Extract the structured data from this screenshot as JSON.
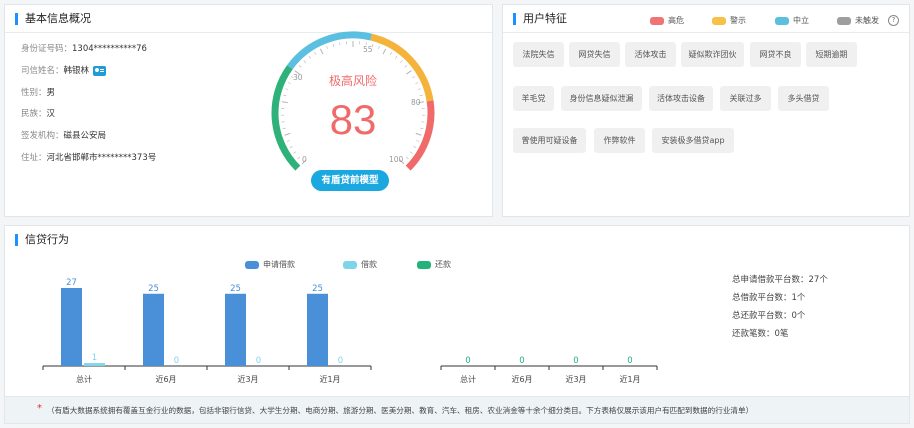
{
  "basic": {
    "title": "基本信息概况",
    "rows": [
      {
        "label": "身份证号码：",
        "value": "1304**********76"
      },
      {
        "label": "司信姓名：",
        "value": "韩银林"
      },
      {
        "label": "性别：",
        "value": "男"
      },
      {
        "label": "民族：",
        "value": "汉"
      },
      {
        "label": "签发机构：",
        "value": "磁县公安局"
      },
      {
        "label": "住址：",
        "value": "河北省邯郸市********373号"
      }
    ],
    "id_icon": "id-card-icon"
  },
  "gauge": {
    "risk_label": "极高风险",
    "score": "83",
    "score_value": 83,
    "ticks": [
      "0",
      "30",
      "55",
      "80",
      "100"
    ],
    "model_button": "有盾贷前模型",
    "colors": {
      "low": "#2fb27a",
      "mid": "#5bbfe0",
      "warn": "#f4b43b",
      "high": "#f06a6a"
    }
  },
  "user_features": {
    "title": "用户特征",
    "legend": [
      {
        "label": "高危",
        "color": "#f07474"
      },
      {
        "label": "警示",
        "color": "#f7c046"
      },
      {
        "label": "中立",
        "color": "#5bc0de"
      },
      {
        "label": "未触发",
        "color": "#9e9e9e"
      }
    ],
    "help_icon": "question-circle-icon",
    "tags": [
      [
        "法院失信",
        "网贷失信",
        "活体攻击",
        "疑似欺诈团伙",
        "网贷不良",
        "短期逾期"
      ],
      [
        "羊毛党",
        "身份信息疑似泄漏",
        "活体攻击设备",
        "关联过多",
        "多头借贷"
      ],
      [
        "曾使用可疑设备",
        "作弊软件",
        "安装极多借贷app"
      ]
    ]
  },
  "credit": {
    "title": "信贷行为",
    "legend": [
      {
        "label": "申请借款",
        "color": "#4a90d9"
      },
      {
        "label": "借款",
        "color": "#7fd4ea"
      },
      {
        "label": "还款",
        "color": "#23b27a"
      }
    ],
    "stats": [
      {
        "label": "总申请借款平台数：",
        "value": "27个"
      },
      {
        "label": "总借款平台数：",
        "value": "1个"
      },
      {
        "label": "总还款平台数：",
        "value": "0个"
      },
      {
        "label": "还款笔数：",
        "value": "0笔"
      }
    ],
    "footer_star": "*",
    "footer_text": "（有盾大数据系统拥有覆盖互金行业的数据，包括非银行信贷、大学生分期、电商分期、旅游分期、医美分期、教育、汽车、租房、农业消金等十余个细分类目。下方表格仅展示该用户有匹配到数据的行业清单）"
  },
  "chart_data": [
    {
      "type": "bar",
      "categories": [
        "总计",
        "近6月",
        "近3月",
        "近1月"
      ],
      "series": [
        {
          "name": "申请借款",
          "values": [
            27,
            25,
            25,
            25
          ],
          "color": "#4a90d9"
        },
        {
          "name": "借款",
          "values": [
            1,
            0,
            0,
            0
          ],
          "color": "#7fd4ea"
        }
      ],
      "ylim": [
        0,
        27
      ]
    },
    {
      "type": "bar",
      "categories": [
        "总计",
        "近6月",
        "近3月",
        "近1月"
      ],
      "series": [
        {
          "name": "还款",
          "values": [
            0,
            0,
            0,
            0
          ],
          "color": "#23b27a"
        }
      ],
      "ylim": [
        0,
        27
      ]
    }
  ]
}
